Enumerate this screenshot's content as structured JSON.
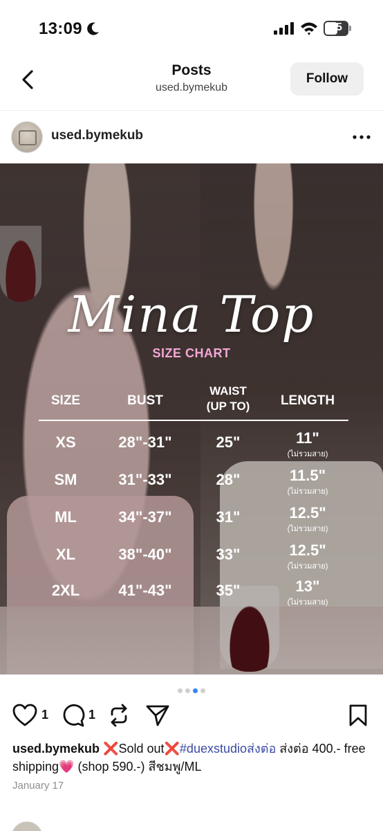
{
  "status_bar": {
    "time": "13:09",
    "battery": "55"
  },
  "nav": {
    "title": "Posts",
    "subtitle": "used.bymekub",
    "follow_label": "Follow"
  },
  "post": {
    "username": "used.bymekub",
    "image": {
      "title": "Mina Top",
      "subtitle": "SIZE CHART",
      "headers": [
        "SIZE",
        "BUST",
        "WAIST\n(UP TO)",
        "LENGTH"
      ],
      "rows": [
        {
          "size": "XS",
          "bust": "28\"-31\"",
          "waist": "25\"",
          "length": "11\"",
          "note": "(ไม่รวมสาย)"
        },
        {
          "size": "SM",
          "bust": "31\"-33\"",
          "waist": "28\"",
          "length": "11.5\"",
          "note": "(ไม่รวมสาย)"
        },
        {
          "size": "ML",
          "bust": "34\"-37\"",
          "waist": "31\"",
          "length": "12.5\"",
          "note": "(ไม่รวมสาย)"
        },
        {
          "size": "XL",
          "bust": "38\"-40\"",
          "waist": "33\"",
          "length": "12.5\"",
          "note": "(ไม่รวมสาย)"
        },
        {
          "size": "2XL",
          "bust": "41\"-43\"",
          "waist": "35\"",
          "length": "13\"",
          "note": "(ไม่รวมสาย)"
        }
      ]
    },
    "carousel": {
      "count": 4,
      "active_index": 2
    },
    "likes": "1",
    "comments": "1",
    "caption": {
      "username": "used.bymekub",
      "text_1": " ❌Sold out❌",
      "hashtag": "#duexstudioส่งต่อ",
      "text_2": " ส่งต่อ 400.- free shipping💗  (shop 590.-) สีชมพู/ML"
    },
    "date": "January 17"
  },
  "colors": {
    "accent_blue": "#3b82f6",
    "hashtag": "#3b4aa5",
    "size_chart_pink": "#f4a7d7",
    "follow_bg": "#efeff0"
  },
  "icons": [
    "moon-icon",
    "signal-icon",
    "wifi-icon",
    "battery-icon",
    "back-chevron-icon",
    "more-icon",
    "heart-icon",
    "comment-icon",
    "repost-icon",
    "share-icon",
    "bookmark-icon"
  ]
}
